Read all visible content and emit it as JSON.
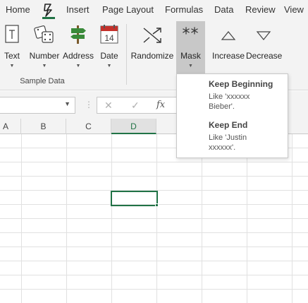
{
  "menubar": {
    "tabs": [
      "Home",
      "Insert",
      "Page Layout",
      "Formulas",
      "Data",
      "Review",
      "View"
    ]
  },
  "ribbon": {
    "buttons": [
      {
        "label": "Text",
        "icon": "text-box-icon"
      },
      {
        "label": "Number",
        "icon": "dice-icon"
      },
      {
        "label": "Address",
        "icon": "signpost-icon"
      },
      {
        "label": "Date",
        "icon": "calendar-icon"
      },
      {
        "label": "Randomize",
        "icon": "shuffle-icon"
      },
      {
        "label": "Mask",
        "icon": "asterisk-mask-icon"
      },
      {
        "label": "Increase",
        "icon": "triangle-up-icon"
      },
      {
        "label": "Decrease",
        "icon": "triangle-down-icon"
      }
    ],
    "calendar_day": "14",
    "mask_glyph": "**",
    "group_label": "Sample Data"
  },
  "formula_bar": {
    "cancel": "✕",
    "enter": "✓",
    "fx": "fx",
    "separator": "⋮"
  },
  "columns": [
    "A",
    "B",
    "C",
    "D"
  ],
  "selected_column": "D",
  "mask_menu": {
    "items": [
      {
        "title": "Keep Beginning",
        "desc1": "Like 'xxxxxx",
        "desc2": "Bieber'."
      },
      {
        "title": "Keep End",
        "desc1": "Like 'Justin",
        "desc2": "xxxxxx'."
      }
    ]
  },
  "colors": {
    "accent": "#217346",
    "ribbon_bg": "#f3f3f3",
    "active_button_bg": "#c8c8c8",
    "calendar_red": "#c4312b"
  }
}
